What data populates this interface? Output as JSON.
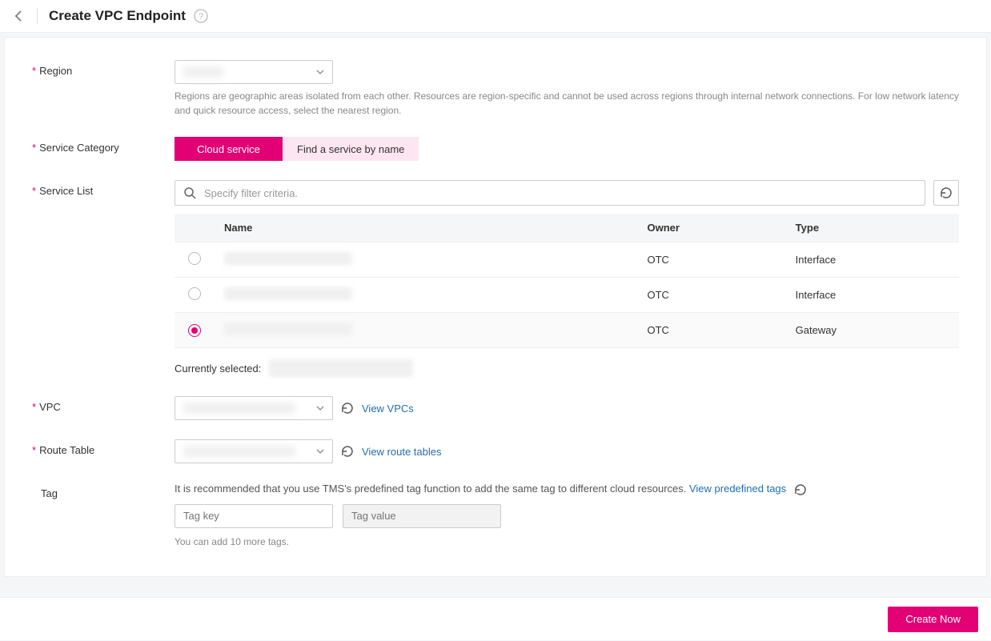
{
  "header": {
    "title": "Create VPC Endpoint"
  },
  "region": {
    "label": "Region",
    "help": "Regions are geographic areas isolated from each other. Resources are region-specific and cannot be used across regions through internal network connections. For low network latency and quick resource access, select the nearest region."
  },
  "serviceCategory": {
    "label": "Service Category",
    "options": {
      "cloud": "Cloud service",
      "byName": "Find a service by name"
    }
  },
  "serviceList": {
    "label": "Service List",
    "searchPlaceholder": "Specify filter criteria.",
    "columns": {
      "name": "Name",
      "owner": "Owner",
      "type": "Type"
    },
    "rows": [
      {
        "owner": "OTC",
        "type": "Interface",
        "selected": false
      },
      {
        "owner": "OTC",
        "type": "Interface",
        "selected": false
      },
      {
        "owner": "OTC",
        "type": "Gateway",
        "selected": true
      }
    ],
    "currentlySelectedLabel": "Currently selected:"
  },
  "vpc": {
    "label": "VPC",
    "viewLink": "View VPCs"
  },
  "routeTable": {
    "label": "Route Table",
    "viewLink": "View route tables"
  },
  "tag": {
    "label": "Tag",
    "hint": "It is recommended that you use TMS's predefined tag function to add the same tag to different cloud resources. ",
    "predefinedLink": "View predefined tags",
    "keyPlaceholder": "Tag key",
    "valuePlaceholder": "Tag value",
    "remainingHint": "You can add 10 more tags."
  },
  "footer": {
    "createNow": "Create Now"
  }
}
